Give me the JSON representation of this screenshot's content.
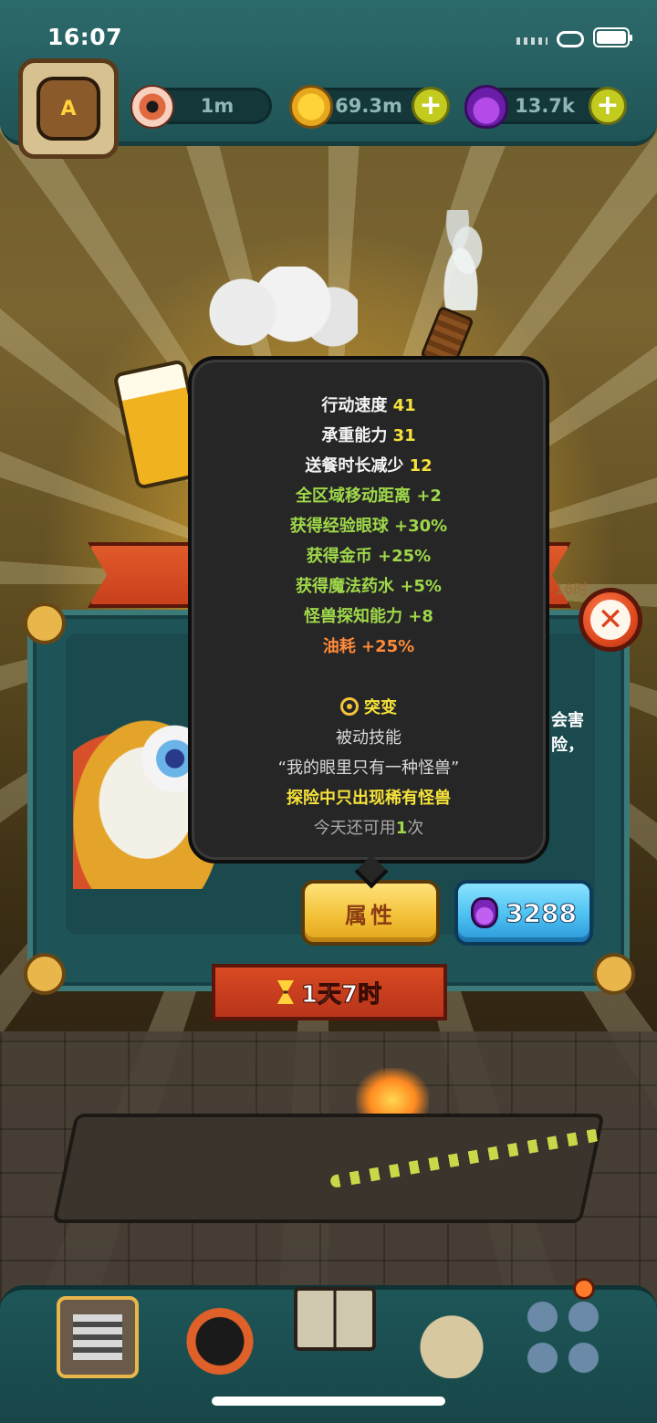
{
  "status_bar": {
    "time": "16:07"
  },
  "resources": [
    {
      "icon": "eye-icon",
      "value": "1m",
      "has_plus": false
    },
    {
      "icon": "coin-icon",
      "value": "69.3m",
      "has_plus": true
    },
    {
      "icon": "potion-icon",
      "value": "13.7k",
      "has_plus": true
    }
  ],
  "tooltip": {
    "stats": [
      {
        "label": "行动速度",
        "value": "41"
      },
      {
        "label": "承重能力",
        "value": "31"
      },
      {
        "label": "送餐时长减少",
        "value": "12"
      }
    ],
    "bonuses": [
      {
        "label": "全区域移动距离",
        "value": "+2"
      },
      {
        "label": "获得经验眼球",
        "value": "+30%"
      },
      {
        "label": "获得金币",
        "value": "+25%"
      },
      {
        "label": "获得魔法药水",
        "value": "+5%"
      },
      {
        "label": "怪兽探知能力",
        "value": "+8"
      }
    ],
    "penalty": {
      "label": "油耗",
      "value": "+25%"
    },
    "mutation": {
      "title": "突变",
      "skill_type": "被动技能",
      "skill_name": "“我的眼里只有一种怪兽”",
      "skill_effect": "探险中只出现稀有怪兽",
      "uses_prefix": "今天还可用",
      "uses_count": "1",
      "uses_suffix": "次"
    }
  },
  "panel": {
    "description_line1": "会害",
    "description_line2": "险，",
    "ribbon_tag": "16时"
  },
  "buttons": {
    "attributes_label": "属性",
    "cost_value": "3288"
  },
  "timer": {
    "text": "1天7时"
  },
  "colors": {
    "stat_value": "#f5e23a",
    "bonus": "#9fd84a",
    "penalty": "#ff8a3a"
  }
}
